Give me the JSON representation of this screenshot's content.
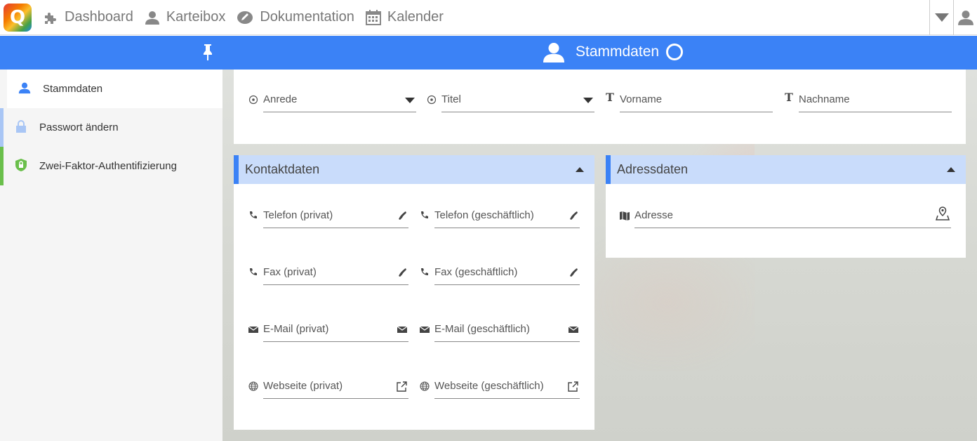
{
  "logo": {
    "letter": "Q"
  },
  "nav": [
    {
      "label": "Dashboard",
      "icon": "puzzle-icon"
    },
    {
      "label": "Karteibox",
      "icon": "user-icon"
    },
    {
      "label": "Dokumentation",
      "icon": "pencil-icon"
    },
    {
      "label": "Kalender",
      "icon": "calendar-icon"
    }
  ],
  "header": {
    "title": "Stammdaten"
  },
  "sidebar": {
    "items": [
      {
        "label": "Stammdaten",
        "accent": "#3b82f6",
        "active": true
      },
      {
        "label": "Passwort ändern",
        "accent": "#a9c6f5",
        "active": false
      },
      {
        "label": "Zwei-Faktor-Authentifizierung",
        "accent": "#6abf4b",
        "active": false
      }
    ]
  },
  "stammdaten": {
    "anrede": "Anrede",
    "titel": "Titel",
    "vorname": "Vorname",
    "nachname": "Nachname"
  },
  "kontakt": {
    "title": "Kontaktdaten",
    "telefon_privat": "Telefon (privat)",
    "telefon_geschaeftlich": "Telefon (geschäftlich)",
    "fax_privat": "Fax (privat)",
    "fax_geschaeftlich": "Fax (geschäftlich)",
    "email_privat": "E-Mail (privat)",
    "email_geschaeftlich": "E-Mail (geschäftlich)",
    "web_privat": "Webseite (privat)",
    "web_geschaeftlich": "Webseite (geschäftlich)"
  },
  "adresse": {
    "title": "Adressdaten",
    "adresse": "Adresse"
  },
  "colors": {
    "primary": "#3b82f6",
    "card_header": "#c9dcfb"
  }
}
